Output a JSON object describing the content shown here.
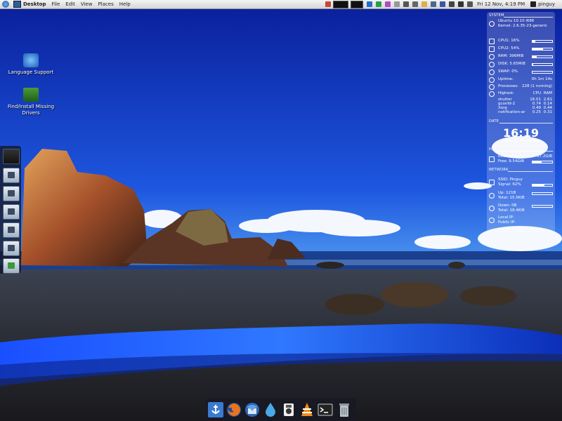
{
  "top_panel": {
    "app_name": "Desktop",
    "menu": [
      "File",
      "Edit",
      "View",
      "Places",
      "Help"
    ],
    "clock": "Fri 12 Nov, 4:19 PM",
    "user": "pinguy"
  },
  "desktop_icons": [
    {
      "label_line1": "Language Support",
      "label_line2": "",
      "icon": "language-support-icon"
    },
    {
      "label_line1": "Find/Install Missing",
      "label_line2": "Drivers",
      "icon": "drivers-icon"
    }
  ],
  "conky": {
    "system_title": "SYSTEM",
    "os": "Ubuntu 10.10 i686",
    "kernel": "Kernel: 2.6.35-23-generic",
    "cpu1": {
      "label": "CPU1: 16%",
      "value": 16
    },
    "cpu2": {
      "label": "CPU2: 54%",
      "value": 54
    },
    "ram": {
      "label": "RAM: 396MiB",
      "value": 20
    },
    "disk": {
      "label": "DISK: 5.65MiB",
      "value": 5
    },
    "swap": {
      "label": "SWAP: 0%",
      "value": 0
    },
    "uptime_label": "Uptime:",
    "uptime_value": "0h 1m 14s",
    "processes_label": "Processes:",
    "processes_value": "228 (1 running)",
    "highest_label": "Highest:",
    "col_cpu": "CPU",
    "col_ram": "RAM",
    "top_procs": [
      {
        "name": "shutter",
        "cpu": "16.01",
        "ram": "2.61"
      },
      {
        "name": "gconfd-2",
        "cpu": "0.74",
        "ram": "0.14"
      },
      {
        "name": "Xorg",
        "cpu": "0.49",
        "ram": "0.44"
      },
      {
        "name": "notification-ar",
        "cpu": "0.25",
        "ram": "0.31"
      }
    ],
    "date_title": "DATE",
    "time": "16:19",
    "date": "Friday 12 November",
    "hd_title": "HD",
    "root": "Root: 46%",
    "root_size": "17.2GiB",
    "root_value": 46,
    "free": "Free: 9.54GiB",
    "network_title": "NETWORK",
    "ssid": "SSID: Pinguy",
    "signal": "Signal: 62%",
    "signal_value": 62,
    "up": "Up: 121B",
    "up_total": "Total: 15.5KiB",
    "down": "Down: 0B",
    "down_total": "Total: 18.4KiB",
    "local_ip": "Local IP:",
    "public_ip": "Public IP:"
  },
  "left_dock": [
    "monitor-icon",
    "home-folder-icon",
    "documents-folder-icon",
    "music-folder-icon",
    "pictures-folder-icon",
    "videos-folder-icon",
    "downloads-folder-icon"
  ],
  "bottom_dock": [
    "anchor-icon",
    "firefox-icon",
    "thunderbird-icon",
    "water-drop-icon",
    "media-player-icon",
    "vlc-icon",
    "terminal-icon",
    "trash-icon"
  ]
}
